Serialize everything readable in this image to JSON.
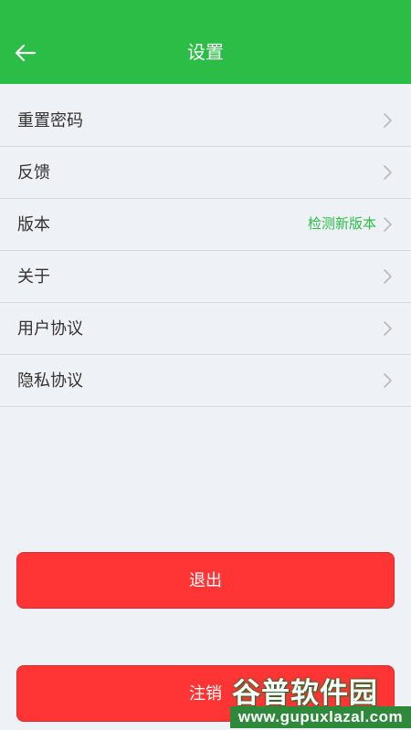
{
  "header": {
    "title": "设置",
    "back_icon": "arrow-left-icon"
  },
  "menu": {
    "items": [
      {
        "label": "重置密码"
      },
      {
        "label": "反馈"
      },
      {
        "label": "版本",
        "extra": "检测新版本"
      },
      {
        "label": "关于"
      },
      {
        "label": "用户协议"
      },
      {
        "label": "隐私协议"
      }
    ]
  },
  "buttons": {
    "logout_label": "退出",
    "cancel_label": "注销"
  },
  "watermark": {
    "title": "谷普软件园",
    "url": "www.gupuxlazal.com"
  },
  "colors": {
    "accent": "#2bbd46",
    "danger": "#ff3535",
    "background": "#eef1f5"
  }
}
